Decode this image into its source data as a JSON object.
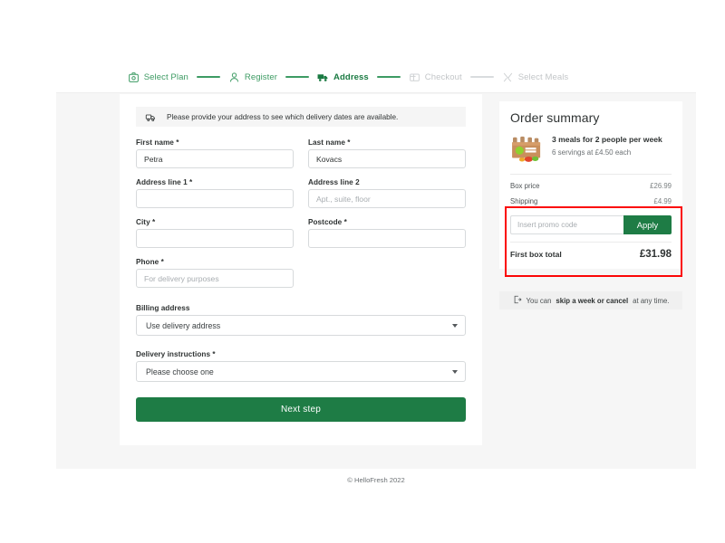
{
  "stepper": {
    "steps": [
      {
        "label": "Select Plan",
        "state": "done",
        "icon": "plan-icon"
      },
      {
        "label": "Register",
        "state": "done",
        "icon": "user-icon"
      },
      {
        "label": "Address",
        "state": "active",
        "icon": "truck-icon"
      },
      {
        "label": "Checkout",
        "state": "todo",
        "icon": "wallet-icon"
      },
      {
        "label": "Select Meals",
        "state": "todo",
        "icon": "cutlery-icon"
      }
    ]
  },
  "notice": {
    "icon": "delivery-truck-icon",
    "text": "Please provide your address to see which delivery dates are available."
  },
  "form": {
    "first_name": {
      "label": "First name *",
      "value": "Petra",
      "placeholder": ""
    },
    "last_name": {
      "label": "Last name *",
      "value": "Kovacs",
      "placeholder": ""
    },
    "address1": {
      "label": "Address line 1 *",
      "value": "",
      "placeholder": ""
    },
    "address2": {
      "label": "Address line 2",
      "value": "",
      "placeholder": "Apt., suite, floor"
    },
    "city": {
      "label": "City *",
      "value": "",
      "placeholder": ""
    },
    "postcode": {
      "label": "Postcode *",
      "value": "",
      "placeholder": ""
    },
    "phone": {
      "label": "Phone *",
      "value": "",
      "placeholder": "For delivery purposes"
    },
    "billing": {
      "label": "Billing address",
      "value": "Use delivery address"
    },
    "instructions": {
      "label": "Delivery instructions *",
      "value": "Please choose one"
    },
    "submit_label": "Next step"
  },
  "summary": {
    "title": "Order summary",
    "plan_title": "3 meals for 2 people per week",
    "plan_subtitle": "6 servings at £4.50 each",
    "lines": [
      {
        "label": "Box price",
        "amount": "£26.99"
      },
      {
        "label": "Shipping",
        "amount": "£4.99"
      }
    ],
    "promo_placeholder": "Insert promo code",
    "promo_button": "Apply",
    "total_label": "First box total",
    "total_amount": "£31.98",
    "highlight_color": "#fb0606"
  },
  "skip_note": {
    "icon": "calendar-skip-icon",
    "prefix": "You can ",
    "bold": "skip a week or cancel",
    "suffix": " at any time."
  },
  "footer": {
    "copyright": "© HelloFresh 2022"
  }
}
